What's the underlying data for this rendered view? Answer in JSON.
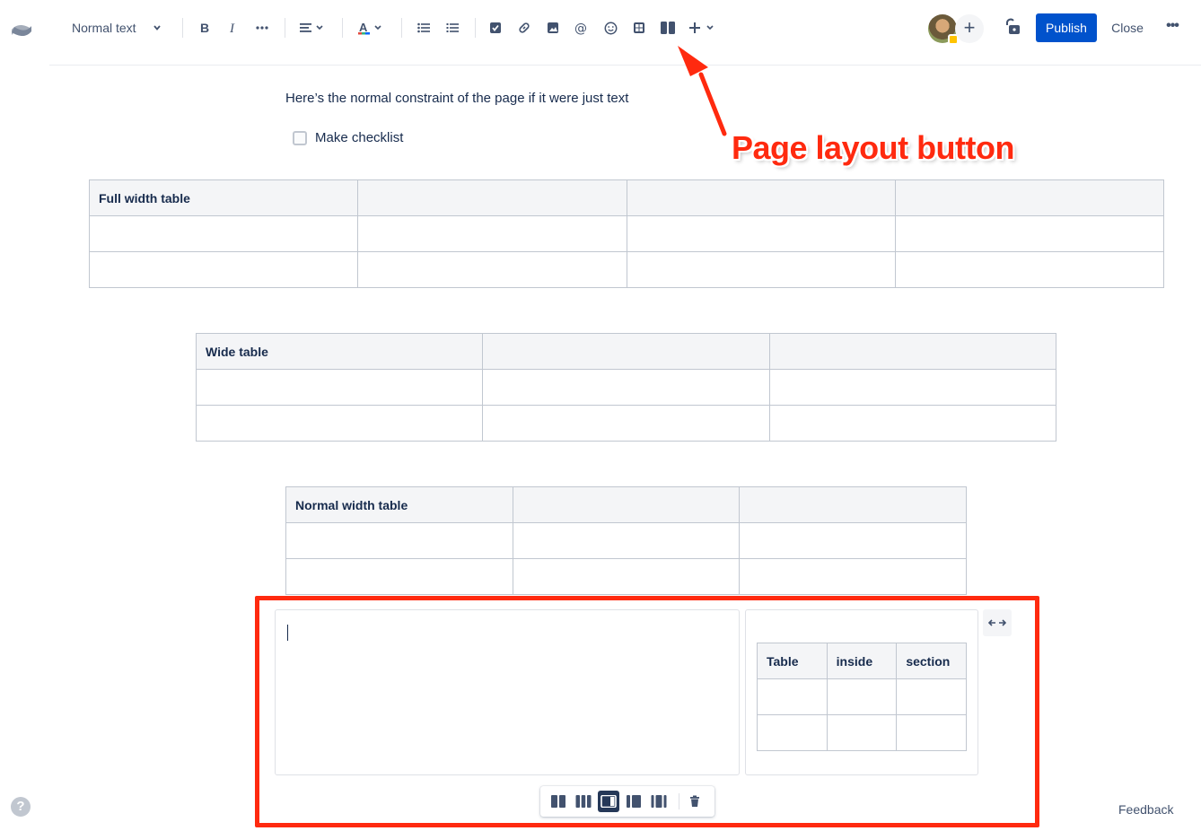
{
  "toolbar": {
    "text_style": "Normal text",
    "publish_label": "Publish",
    "close_label": "Close",
    "more_label": "•••",
    "add_label": "+",
    "icons": [
      "bold-icon",
      "italic-icon",
      "more-formatting-icon",
      "align-icon",
      "text-color-icon",
      "bullet-list-icon",
      "numbered-list-icon",
      "action-item-icon",
      "link-icon",
      "image-icon",
      "mention-icon",
      "emoji-icon",
      "table-icon",
      "page-layout-icon",
      "insert-icon"
    ]
  },
  "annotation": {
    "label": "Page layout button",
    "color": "#ff2a0f"
  },
  "content": {
    "intro_text": "Here’s the normal constraint of the page if it were just text",
    "checklist_label": "Make checklist",
    "full_table_header": "Full width table",
    "wide_table_header": "Wide table",
    "normal_table_header": "Normal width table",
    "inner_table_headers": [
      "Table",
      "inside",
      "section"
    ]
  },
  "layout_toolbar": {
    "options": [
      "two-equal-columns-icon",
      "three-columns-icon",
      "right-sidebar-icon",
      "left-sidebar-icon",
      "three-with-sidebars-icon"
    ],
    "selected": "right-sidebar-icon",
    "delete_icon": "trash-icon",
    "resize_icon": "expand-width-icon"
  },
  "footer": {
    "feedback": "Feedback",
    "help": "?"
  },
  "colors": {
    "primary_button": "#0052cc",
    "text": "#172b4d",
    "icon": "#42526e",
    "annotation": "#ff2a0f"
  }
}
